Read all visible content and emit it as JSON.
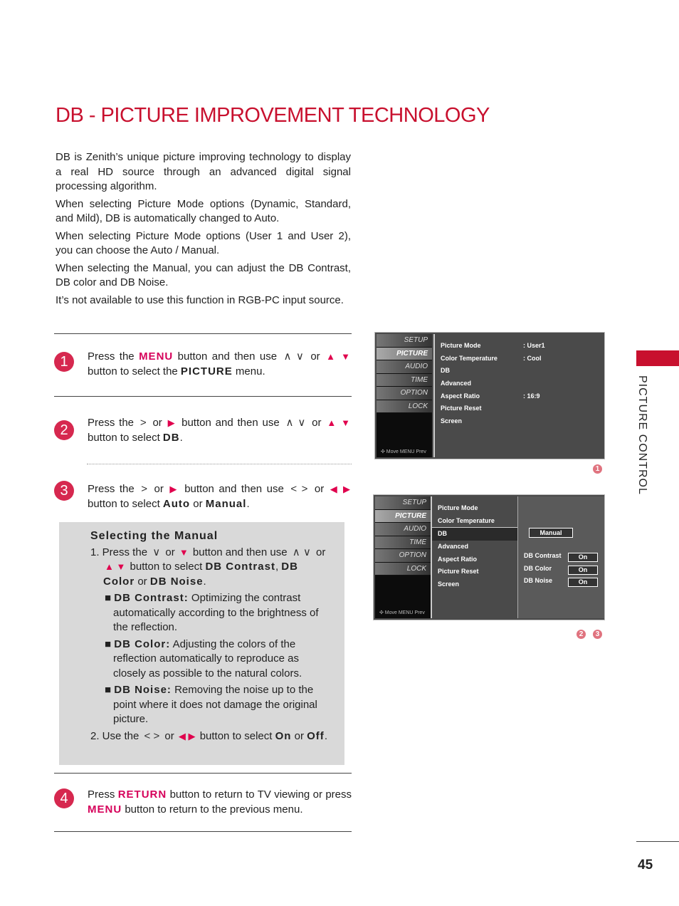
{
  "title": "DB - PICTURE IMPROVEMENT TECHNOLOGY",
  "intro": [
    "DB is Zenith’s unique picture improving technology to display a real HD source through an advanced digital signal processing algorithm.",
    "When selecting Picture Mode options (Dynamic, Standard, and Mild), DB is automatically changed to Auto.",
    "When selecting Picture Mode options (User 1 and User 2), you can choose the Auto / Manual.",
    "When selecting the Manual, you can adjust the DB Contrast, DB color and DB Noise.",
    "It’s not available to use this function in RGB-PC input source."
  ],
  "steps": [
    {
      "num": "1",
      "segs": [
        {
          "k": "n",
          "t": "Press the "
        },
        {
          "k": "r",
          "t": "MENU"
        },
        {
          "k": "n",
          "t": " button and then use "
        },
        {
          "k": "ic",
          "t": "∧ ∨"
        },
        {
          "k": "n",
          "t": " or "
        },
        {
          "k": "icr",
          "t": "▲ ▼"
        },
        {
          "k": "n",
          "t": " button to select the "
        },
        {
          "k": "b",
          "t": "PICTURE"
        },
        {
          "k": "n",
          "t": " menu."
        }
      ]
    },
    {
      "num": "2",
      "segs": [
        {
          "k": "n",
          "t": "Press the "
        },
        {
          "k": "ic",
          "t": ">"
        },
        {
          "k": "n",
          "t": " or "
        },
        {
          "k": "icr",
          "t": "▶"
        },
        {
          "k": "n",
          "t": " button and then use "
        },
        {
          "k": "ic",
          "t": "∧ ∨"
        },
        {
          "k": "n",
          "t": " or "
        },
        {
          "k": "icr",
          "t": "▲ ▼"
        },
        {
          "k": "n",
          "t": " button to select "
        },
        {
          "k": "b",
          "t": "DB"
        },
        {
          "k": "n",
          "t": "."
        }
      ]
    },
    {
      "num": "3",
      "segs": [
        {
          "k": "n",
          "t": "Press the "
        },
        {
          "k": "ic",
          "t": ">"
        },
        {
          "k": "n",
          "t": " or "
        },
        {
          "k": "icr",
          "t": "▶"
        },
        {
          "k": "n",
          "t": " button and then use "
        },
        {
          "k": "ic",
          "t": "< >"
        },
        {
          "k": "n",
          "t": " or "
        },
        {
          "k": "icr",
          "t": "◀ ▶"
        },
        {
          "k": "n",
          "t": " button to select "
        },
        {
          "k": "b",
          "t": "Auto"
        },
        {
          "k": "n",
          "t": " or "
        },
        {
          "k": "b",
          "t": "Manual"
        },
        {
          "k": "n",
          "t": "."
        }
      ]
    },
    {
      "num": "4",
      "segs": [
        {
          "k": "n",
          "t": "Press "
        },
        {
          "k": "r",
          "t": "RETURN"
        },
        {
          "k": "n",
          "t": " button to return to TV viewing or press "
        },
        {
          "k": "r",
          "t": "MENU"
        },
        {
          "k": "n",
          "t": " button to return to the previous menu."
        }
      ]
    }
  ],
  "manual": {
    "title": "Selecting the Manual",
    "items": [
      {
        "cls": "mi",
        "segs": [
          {
            "k": "n",
            "t": "1. Press the "
          },
          {
            "k": "ic",
            "t": "∨"
          },
          {
            "k": "n",
            "t": " or "
          },
          {
            "k": "icr",
            "t": "▼"
          },
          {
            "k": "n",
            "t": " button and then use "
          },
          {
            "k": "ic",
            "t": "∧ ∨"
          },
          {
            "k": "n",
            "t": " or "
          },
          {
            "k": "icr",
            "t": "▲ ▼"
          },
          {
            "k": "n",
            "t": " button to select "
          },
          {
            "k": "b",
            "t": "DB Contrast"
          },
          {
            "k": "n",
            "t": ", "
          },
          {
            "k": "b",
            "t": "DB Color"
          },
          {
            "k": "n",
            "t": " or "
          },
          {
            "k": "b",
            "t": "DB Noise"
          },
          {
            "k": "n",
            "t": "."
          }
        ]
      },
      {
        "cls": "sub",
        "segs": [
          {
            "k": "n",
            "t": "■ "
          },
          {
            "k": "b",
            "t": "DB Contrast:"
          },
          {
            "k": "n",
            "t": " Optimizing the contrast automatically according to the brightness of the reflection."
          }
        ]
      },
      {
        "cls": "sub",
        "segs": [
          {
            "k": "n",
            "t": "■ "
          },
          {
            "k": "b",
            "t": "DB Color:"
          },
          {
            "k": "n",
            "t": " Adjusting the colors of the reflection automatically to reproduce as closely as possible to the natural colors."
          }
        ]
      },
      {
        "cls": "sub",
        "segs": [
          {
            "k": "n",
            "t": "■ "
          },
          {
            "k": "b",
            "t": "DB Noise:"
          },
          {
            "k": "n",
            "t": " Removing the noise up to the point where it does not damage the original picture."
          }
        ]
      },
      {
        "cls": "mi",
        "segs": [
          {
            "k": "n",
            "t": "2. Use the "
          },
          {
            "k": "ic",
            "t": "< >"
          },
          {
            "k": "n",
            "t": " or "
          },
          {
            "k": "icr",
            "t": "◀ ▶"
          },
          {
            "k": "n",
            "t": " button to select "
          },
          {
            "k": "b",
            "t": "On"
          },
          {
            "k": "n",
            "t": " or "
          },
          {
            "k": "b",
            "t": "Off"
          },
          {
            "k": "n",
            "t": "."
          }
        ]
      }
    ]
  },
  "osd_side": [
    "SETUP",
    "PICTURE",
    "AUDIO",
    "TIME",
    "OPTION",
    "LOCK"
  ],
  "osd_footer": "✣ Move  MENU Prev",
  "osd1": {
    "rows": [
      {
        "label": "Picture Mode",
        "value": ": User1"
      },
      {
        "label": "Color Temperature",
        "value": ": Cool"
      },
      {
        "label": "DB",
        "value": ""
      },
      {
        "label": "Advanced",
        "value": ""
      },
      {
        "label": "Aspect Ratio",
        "value": ": 16:9"
      },
      {
        "label": "Picture Reset",
        "value": ""
      },
      {
        "label": "Screen",
        "value": ""
      }
    ],
    "badge": "1"
  },
  "osd2": {
    "rows": [
      "Picture Mode",
      "Color Temperature",
      "DB",
      "Advanced",
      "Aspect Ratio",
      "Picture Reset",
      "Screen"
    ],
    "arrow": "▶",
    "mode": "Manual",
    "subs": [
      {
        "label": "DB Contrast",
        "value": "On"
      },
      {
        "label": "DB Color",
        "value": "On"
      },
      {
        "label": "DB Noise",
        "value": "On"
      }
    ],
    "badges": [
      "2",
      "3"
    ]
  },
  "side_label": "PICTURE CONTROL",
  "page_number": "45",
  "colors": {
    "accent": "#c8102e",
    "step": "#d6284f",
    "box": "#d9d9d9"
  }
}
